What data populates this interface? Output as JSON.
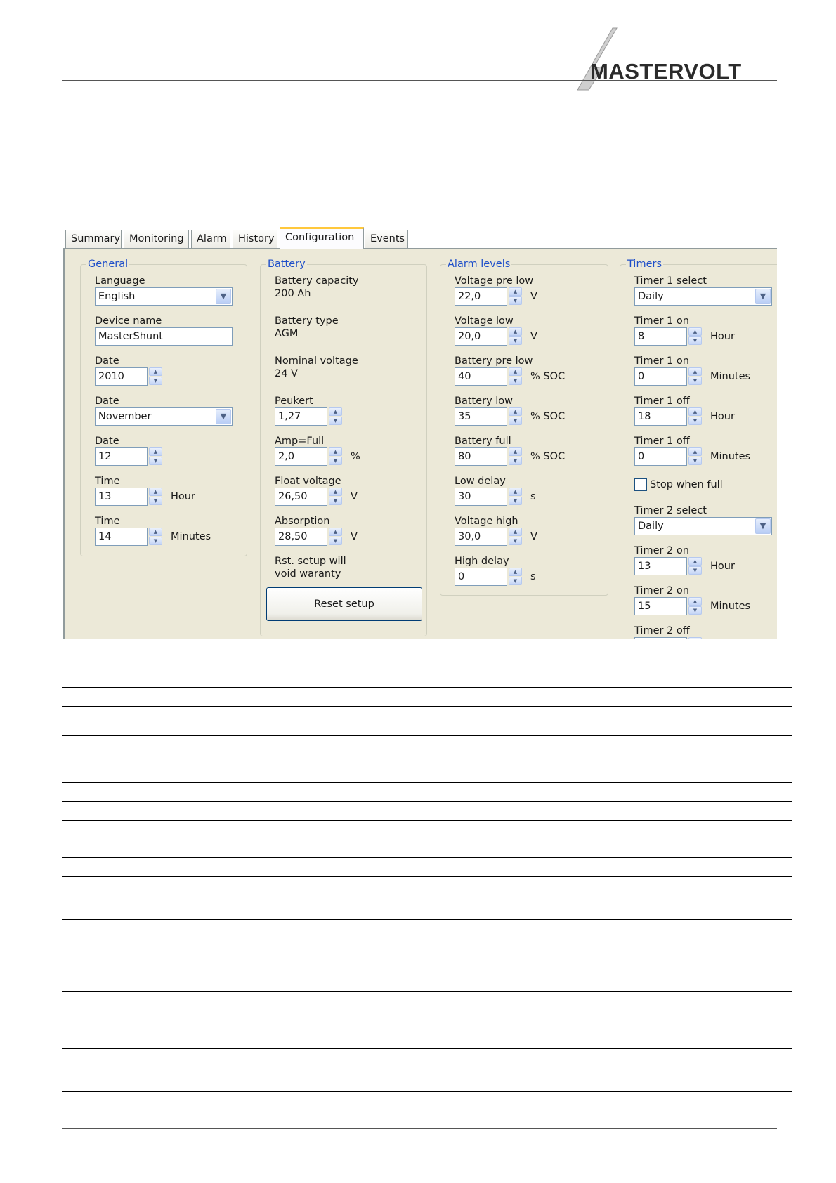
{
  "header": {
    "brand": "MASTERVOLT"
  },
  "tabs": [
    {
      "label": "Summary"
    },
    {
      "label": "Monitoring"
    },
    {
      "label": "Alarm"
    },
    {
      "label": "History"
    },
    {
      "label": "Configuration",
      "active": true
    },
    {
      "label": "Events"
    }
  ],
  "general": {
    "title": "General",
    "language_label": "Language",
    "language_value": "English",
    "device_name_label": "Device name",
    "device_name_value": "MasterShunt",
    "year_label": "Date",
    "year_value": "2010",
    "month_label": "Date",
    "month_value": "November",
    "day_label": "Date",
    "day_value": "12",
    "hour_label": "Time",
    "hour_value": "13",
    "hour_unit": "Hour",
    "minute_label": "Time",
    "minute_value": "14",
    "minute_unit": "Minutes"
  },
  "battery": {
    "title": "Battery",
    "capacity_label": "Battery capacity",
    "capacity_value": "200 Ah",
    "type_label": "Battery type",
    "type_value": "AGM",
    "nominal_label": "Nominal voltage",
    "nominal_value": "24 V",
    "peukert_label": "Peukert",
    "peukert_value": "1,27",
    "ampfull_label": "Amp=Full",
    "ampfull_value": "2,0",
    "ampfull_unit": "%",
    "float_label": "Float voltage",
    "float_value": "26,50",
    "float_unit": "V",
    "absorption_label": "Absorption",
    "absorption_value": "28,50",
    "absorption_unit": "V",
    "reset_note_1": "Rst. setup will",
    "reset_note_2": "void waranty",
    "reset_button": "Reset setup"
  },
  "alarm": {
    "title": "Alarm levels",
    "vprelow_label": "Voltage pre low",
    "vprelow_value": "22,0",
    "vprelow_unit": "V",
    "vlow_label": "Voltage low",
    "vlow_value": "20,0",
    "vlow_unit": "V",
    "bprelow_label": "Battery pre low",
    "bprelow_value": "40",
    "bprelow_unit": "% SOC",
    "blow_label": "Battery low",
    "blow_value": "35",
    "blow_unit": "% SOC",
    "bfull_label": "Battery full",
    "bfull_value": "80",
    "bfull_unit": "% SOC",
    "lowdelay_label": "Low delay",
    "lowdelay_value": "30",
    "lowdelay_unit": "s",
    "vhigh_label": "Voltage high",
    "vhigh_value": "30,0",
    "vhigh_unit": "V",
    "highdelay_label": "High delay",
    "highdelay_value": "0",
    "highdelay_unit": "s"
  },
  "timers": {
    "title": "Timers",
    "t1select_label": "Timer 1 select",
    "t1select_value": "Daily",
    "t1onh_label": "Timer 1 on",
    "t1onh_value": "8",
    "t1onh_unit": "Hour",
    "t1onm_label": "Timer 1 on",
    "t1onm_value": "0",
    "t1onm_unit": "Minutes",
    "t1offh_label": "Timer 1 off",
    "t1offh_value": "18",
    "t1offh_unit": "Hour",
    "t1offm_label": "Timer 1 off",
    "t1offm_value": "0",
    "t1offm_unit": "Minutes",
    "stop_when_full": "Stop when full",
    "t2select_label": "Timer 2 select",
    "t2select_value": "Daily",
    "t2onh_label": "Timer 2 on",
    "t2onh_value": "13",
    "t2onh_unit": "Hour",
    "t2onm_label": "Timer 2 on",
    "t2onm_value": "15",
    "t2onm_unit": "Minutes",
    "t2off_label": "Timer 2 off"
  }
}
